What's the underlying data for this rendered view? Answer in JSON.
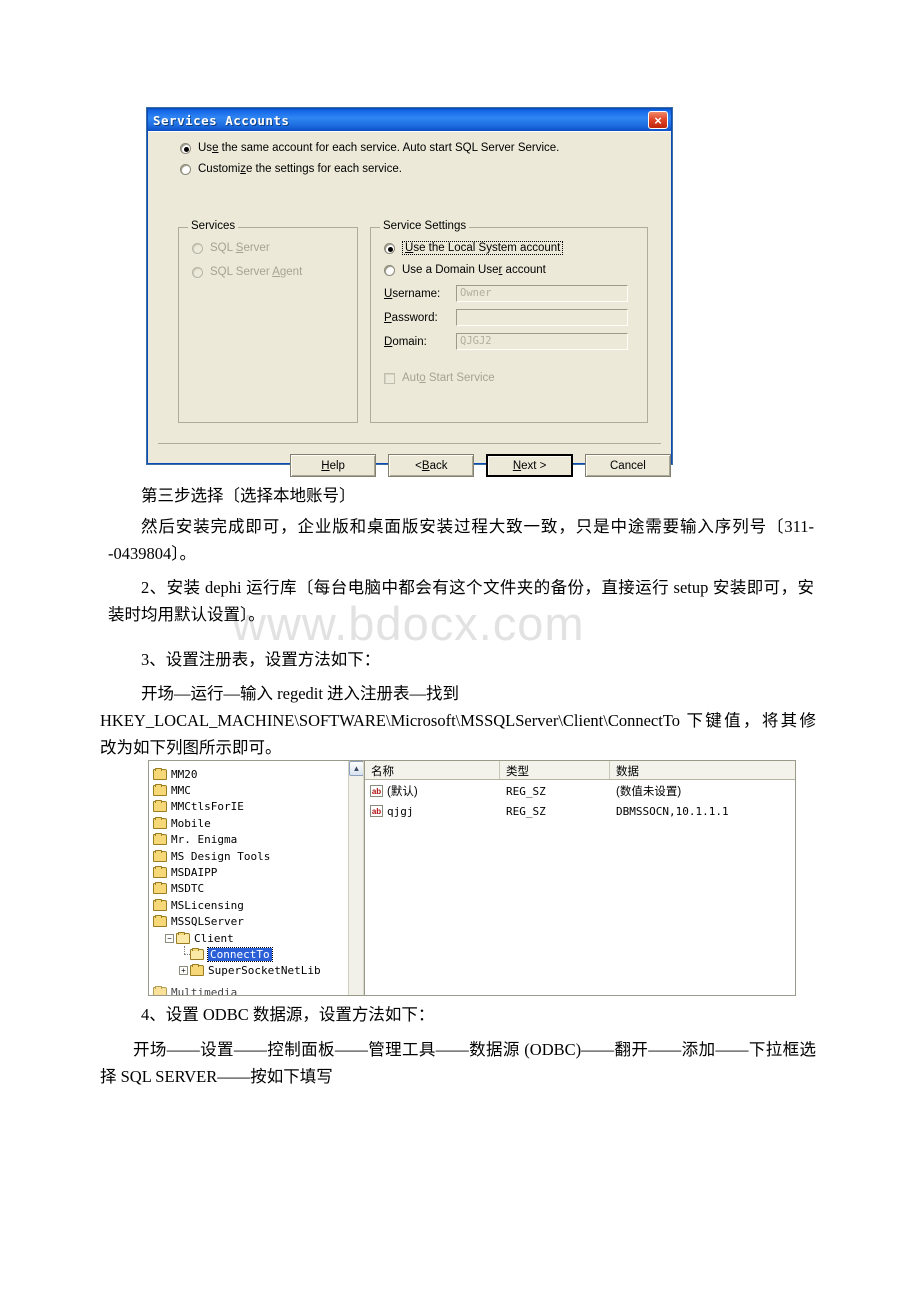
{
  "watermark": "www.bdocx.com",
  "dialog": {
    "title": "Services Accounts",
    "close_label": "×",
    "top_options": [
      {
        "label_pre": "Us",
        "label_u": "e",
        "label_post": " the same account for each service. Auto start SQL Server Service.",
        "checked": true
      },
      {
        "label_pre": "Customi",
        "label_u": "z",
        "label_post": "e the settings for each service.",
        "checked": false
      }
    ],
    "services_group": {
      "title": "Services",
      "items": [
        {
          "label_pre": "SQL ",
          "label_u": "S",
          "label_post": "erver",
          "checked": false,
          "disabled": true
        },
        {
          "label_pre": "SQL Server ",
          "label_u": "A",
          "label_post": "gent",
          "checked": false,
          "disabled": true
        }
      ]
    },
    "settings_group": {
      "title": "Service Settings",
      "options": [
        {
          "label_pre": "",
          "label_u": "U",
          "label_post": "se the Local System account",
          "checked": true,
          "focused": true
        },
        {
          "label_pre": "Use a Domain Use",
          "label_u": "r",
          "label_post": " account",
          "checked": false,
          "focused": false
        }
      ],
      "fields": [
        {
          "label_pre": "",
          "label_u": "U",
          "label_post": "sername:",
          "value": "Owner",
          "disabled": true
        },
        {
          "label_pre": "",
          "label_u": "P",
          "label_post": "assword:",
          "value": "",
          "disabled": true
        },
        {
          "label_pre": "",
          "label_u": "D",
          "label_post": "omain:",
          "value": "QJGJ2",
          "disabled": true
        }
      ],
      "checkbox": {
        "label_pre": "Aut",
        "label_u": "o",
        "label_post": " Start Service",
        "checked": false,
        "disabled": true
      }
    },
    "buttons": [
      {
        "pre": "",
        "u": "H",
        "post": "elp",
        "default": false
      },
      {
        "pre": "< ",
        "u": "B",
        "post": "ack",
        "default": false
      },
      {
        "pre": "",
        "u": "N",
        "post": "ext >",
        "default": true
      },
      {
        "pre": "Cancel",
        "u": "",
        "post": "",
        "default": false
      }
    ]
  },
  "paragraphs": {
    "p1": "第三步选择〔选择本地账号〕",
    "p2": "然后安装完成即可，企业版和桌面版安装过程大致一致，只是中途需要输入序列号〔311--0439804〕。",
    "p3": "2、安装 dephi 运行库〔每台电脑中都会有这个文件夹的备份，直接运行 setup 安装即可，安装时均用默认设置〕。",
    "p4": "3、设置注册表，设置方法如下：",
    "p5": "开场—运行—输入 regedit 进入注册表—找到",
    "p6": "HKEY_LOCAL_MACHINE\\SOFTWARE\\Microsoft\\MSSQLServer\\Client\\ConnectTo 下键值，将其修改为如下列图所示即可。",
    "p7": "4、设置 ODBC 数据源，设置方法如下：",
    "p8": "开场——设置——控制面板——管理工具——数据源 (ODBC)——翻开——添加——下拉框选择 SQL SERVER——按如下填写"
  },
  "regedit": {
    "tree": [
      {
        "label": "MM20",
        "level": 0,
        "expander": "",
        "selected": false
      },
      {
        "label": "MMC",
        "level": 0,
        "expander": "",
        "selected": false
      },
      {
        "label": "MMCtlsForIE",
        "level": 0,
        "expander": "",
        "selected": false
      },
      {
        "label": "Mobile",
        "level": 0,
        "expander": "",
        "selected": false
      },
      {
        "label": "Mr. Enigma",
        "level": 0,
        "expander": "",
        "selected": false
      },
      {
        "label": "MS Design Tools",
        "level": 0,
        "expander": "",
        "selected": false
      },
      {
        "label": "MSDAIPP",
        "level": 0,
        "expander": "",
        "selected": false
      },
      {
        "label": "MSDTC",
        "level": 0,
        "expander": "",
        "selected": false
      },
      {
        "label": "MSLicensing",
        "level": 0,
        "expander": "",
        "selected": false
      },
      {
        "label": "MSSQLServer",
        "level": 0,
        "expander": "",
        "selected": false
      },
      {
        "label": "Client",
        "level": 1,
        "expander": "−",
        "selected": false
      },
      {
        "label": "ConnectTo",
        "level": 2,
        "expander": "",
        "selected": true
      },
      {
        "label": "SuperSocketNetLib",
        "level": 2,
        "expander": "+",
        "selected": false
      }
    ],
    "clipped_label": "Multimedia",
    "scroll_up_glyph": "▲",
    "columns": [
      "名称",
      "类型",
      "数据"
    ],
    "rows": [
      {
        "icon": "ab",
        "name": "(默认)",
        "type": "REG_SZ",
        "data": "(数值未设置)"
      },
      {
        "icon": "ab",
        "name": "qjgj",
        "type": "REG_SZ",
        "data": "DBMSSOCN,10.1.1.1"
      }
    ]
  }
}
